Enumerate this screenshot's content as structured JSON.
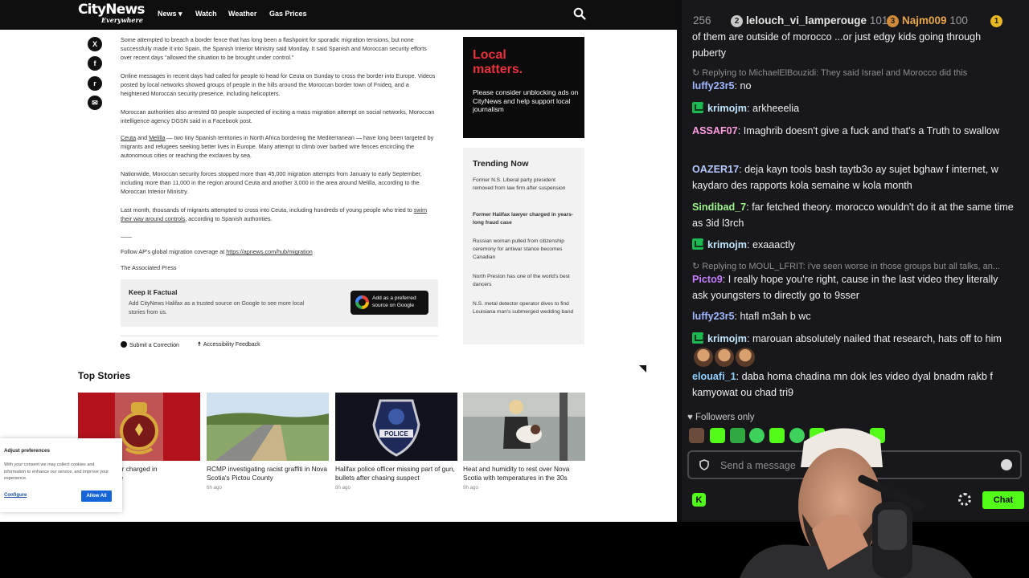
{
  "site": {
    "logo": "CityNews",
    "logo_sub": "Everywhere",
    "nav": [
      "News",
      "Watch",
      "Weather",
      "Gas Prices"
    ],
    "nav_news_caret": "▾",
    "share_icons": [
      "x-icon",
      "facebook-icon",
      "reddit-icon",
      "email-icon"
    ],
    "share_glyphs": [
      "X",
      "f",
      "r",
      "✉"
    ],
    "article": {
      "p1": "Some attempted to breach a border fence that has long been a flashpoint for sporadic migration tensions, but none successfully made it into Spain, the Spanish Interior Ministry said Monday. It said Spanish and Moroccan security efforts over recent days “allowed the situation to be brought under control.”",
      "p2": "Online messages in recent days had called for people to head for Ceuta on Sunday to cross the border into Europe. Videos posted by local networks showed groups of people in the hills around the Moroccan border town of Fnideq, and a heightened Moroccan security presence, including helicopters.",
      "p3": "Moroccan authorities also arrested 60 people suspected of inciting a mass migration attempt on social networks, Moroccan intelligence agency DGSN said in a Facebook post.",
      "p4_link1": "Ceuta",
      "p4_and": " and ",
      "p4_link2": "Melilla",
      "p4_rest": " — two tiny Spanish territories in North Africa bordering the Mediterranean — have long been targeted by migrants and refugees seeking better lives in Europe. Many attempt to climb over barbed wire fences encircling the autonomous cities or reaching the exclaves by sea.",
      "p5": "Nationwide, Moroccan security forces stopped more than 45,000 migration attempts from January to early September, including more than 11,000 in the region around Ceuta and another 3,000 in the area around Melilla, according to the Moroccan Interior Ministry.",
      "p6_start": "Last month, thousands of migrants attempted to cross into Ceuta, including hundreds of young people who tried to ",
      "p6_link": "swim their way around controls",
      "p6_end": ", according to Spanish authorities.",
      "p7_start": "Follow AP's global migration coverage at ",
      "p7_link": "https://apnews.com/hub/migration",
      "p8": "The Associated Press"
    },
    "keep_factual": {
      "title": "Keep it Factual",
      "desc": "Add CityNews Halifax as a trusted source on Google to see more local stories from us.",
      "button": "Add as a preferred source on Google"
    },
    "submit_correction": "Submit a Correction",
    "accessibility_feedback": "Accessibility Feedback",
    "ad": {
      "headline": "Local matters.",
      "text": "Please consider unblocking ads on CityNews and help support local journalism"
    },
    "trending": {
      "title": "Trending Now",
      "items": [
        "Former N.S. Liberal party president removed from law firm after suspension",
        "Former Halifax lawyer charged in years-long fraud case",
        "Russian woman pulled from citizenship ceremony for antiwar stance becomes Canadian",
        "North Preston has one of the world's best dancers",
        "N.S. metal detector operator dives to find Louisiana man's submerged wedding band"
      ]
    },
    "top_stories": {
      "title": "Top Stories",
      "cards": [
        {
          "title": "x lawyer charged in\nud case",
          "age": ""
        },
        {
          "title": "RCMP investigating racist graffiti in Nova Scotia's Pictou County",
          "age": "6h ago"
        },
        {
          "title": "Halifax police officer missing part of gun, bullets after chasing suspect",
          "age": "8h ago"
        },
        {
          "title": "Heat and humidity to rest over Nova Scotia with temperatures in the 30s",
          "age": "9h ago"
        }
      ],
      "police_text": "POLICE"
    },
    "cookie": {
      "title": "Adjust preferences",
      "text": "With your consent we may collect cookies and information to enhance our service, and improve your experience.",
      "configure": "Configure",
      "allow": "Allow All"
    }
  },
  "chat": {
    "leaderboard": {
      "first_count": "256",
      "entries": [
        {
          "rank": "2",
          "name": "lelouch_vi_lamperouge",
          "count": "101",
          "color": "#c9c9c9"
        },
        {
          "rank": "3",
          "name": "Najm009",
          "count": "100",
          "color": "#d08a3a"
        },
        {
          "rank": "1",
          "name": "",
          "count": "",
          "color": "#e8b820"
        }
      ]
    },
    "messages": [
      {
        "type": "cont",
        "text": "of them are outside of morocco ...or just edgy kids going through puberty"
      },
      {
        "type": "reply",
        "text": "Replying to MichaelElBouzidi: They said Israel and Morocco did this"
      },
      {
        "type": "msg",
        "user": "luffy23r5",
        "color": "#9fb7ff",
        "text": "no"
      },
      {
        "type": "msg",
        "user": "krimojm",
        "color": "#bfe5ff",
        "badge": true,
        "text": "arkheeelia"
      },
      {
        "type": "msg",
        "user": "ASSAF07",
        "color": "#ff9ee0",
        "text": "Imaghrib doesn't give a fuck and that's a Truth to swallow"
      },
      {
        "type": "msg",
        "user": "OAZER17",
        "color": "#b5c8ff",
        "text": "deja kayn tools bash taytb3o ay sujet bghaw f internet, w kaydaro des rapports kola semaine w kola month"
      },
      {
        "type": "msg",
        "user": "Sindibad_7",
        "color": "#9cf58a",
        "text": "far fetched theory. morocco wouldn't do it at the same time as 3id l3rch"
      },
      {
        "type": "msg",
        "user": "krimojm",
        "color": "#bfe5ff",
        "badge": true,
        "text": "exaaactly"
      },
      {
        "type": "reply",
        "text": "Replying to MOUL_LFRIT: i've seen worse in those groups but all talks, an..."
      },
      {
        "type": "msg",
        "user": "Picto9",
        "color": "#c77dff",
        "text": "I really hope you're right, cause in the last video they literally ask youngsters to directly go to 9sser"
      },
      {
        "type": "msg",
        "user": "luffy23r5",
        "color": "#9fb7ff",
        "text": "htafl m3ah b wc"
      },
      {
        "type": "msg",
        "user": "krimojm",
        "color": "#bfe5ff",
        "badge": true,
        "text": "marouan absolutely nailed that research, hats off to him"
      },
      {
        "type": "msg",
        "user": "elouafi_1",
        "color": "#8fd0ff",
        "text": "daba homa chadina mn dok les video dyal bnadm rakb f kamyowat ou chad tri9"
      }
    ],
    "followers_only": "Followers only",
    "input_placeholder": "Send a message",
    "chat_button": "Chat"
  }
}
